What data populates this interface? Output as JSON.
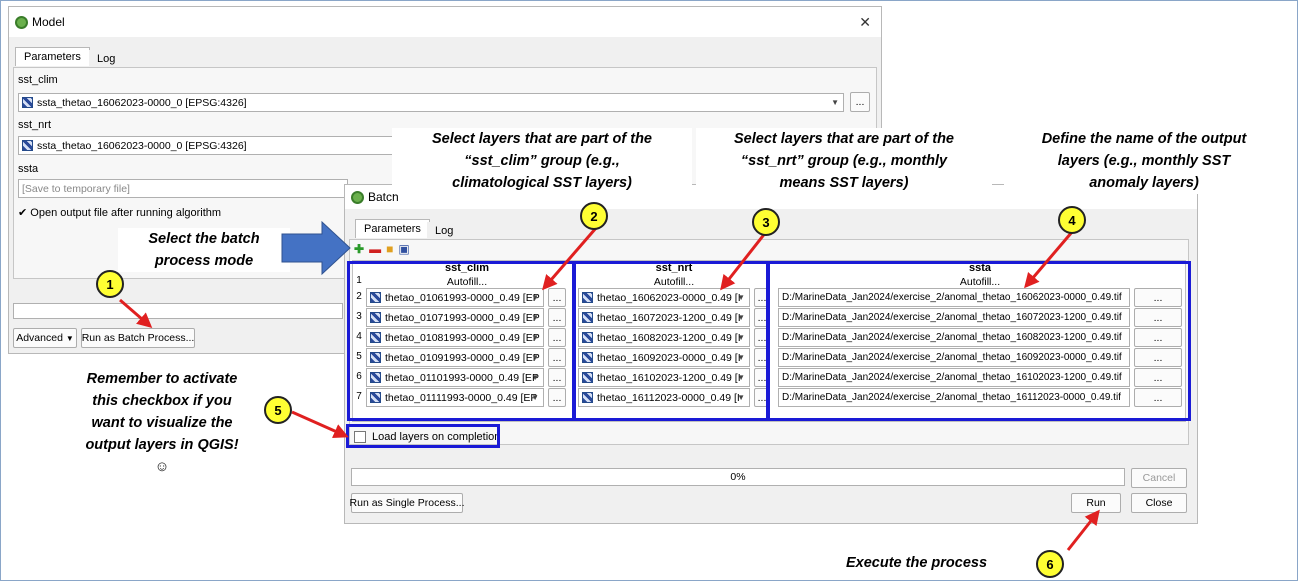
{
  "model_window": {
    "title": "Model",
    "tabs": [
      "Parameters",
      "Log"
    ],
    "sst_clim_label": "sst_clim",
    "sst_clim_value": "ssta_thetao_16062023-0000_0 [EPSG:4326]",
    "sst_nrt_label": "sst_nrt",
    "sst_nrt_value": "ssta_thetao_16062023-0000_0 [EPSG:4326]",
    "ssta_label": "ssta",
    "ssta_placeholder": "[Save to temporary file]",
    "open_output_label": "Open output file after running algorithm",
    "advanced_label": "Advanced",
    "run_batch_label": "Run as Batch Process...",
    "ellipsis": "..."
  },
  "batch_window": {
    "title": "Batch",
    "tabs": [
      "Parameters",
      "Log"
    ],
    "columns": [
      "sst_clim",
      "sst_nrt",
      "ssta"
    ],
    "autofill": "Autofill...",
    "rows": [
      {
        "n": "1"
      },
      {
        "n": "2",
        "clim": "thetao_01061993-0000_0.49 [EP",
        "nrt": "thetao_16062023-0000_0.49 [I",
        "out": "D:/MarineData_Jan2024/exercise_2/anomal_thetao_16062023-0000_0.49.tif"
      },
      {
        "n": "3",
        "clim": "thetao_01071993-0000_0.49 [EP",
        "nrt": "thetao_16072023-1200_0.49 [I",
        "out": "D:/MarineData_Jan2024/exercise_2/anomal_thetao_16072023-1200_0.49.tif"
      },
      {
        "n": "4",
        "clim": "thetao_01081993-0000_0.49 [EP",
        "nrt": "thetao_16082023-1200_0.49 [I",
        "out": "D:/MarineData_Jan2024/exercise_2/anomal_thetao_16082023-1200_0.49.tif"
      },
      {
        "n": "5",
        "clim": "thetao_01091993-0000_0.49 [EP",
        "nrt": "thetao_16092023-0000_0.49 [I",
        "out": "D:/MarineData_Jan2024/exercise_2/anomal_thetao_16092023-0000_0.49.tif"
      },
      {
        "n": "6",
        "clim": "thetao_01101993-0000_0.49 [EP",
        "nrt": "thetao_16102023-1200_0.49 [I",
        "out": "D:/MarineData_Jan2024/exercise_2/anomal_thetao_16102023-1200_0.49.tif"
      },
      {
        "n": "7",
        "clim": "thetao_01111993-0000_0.49 [EP",
        "nrt": "thetao_16112023-0000_0.49 [I",
        "out": "D:/MarineData_Jan2024/exercise_2/anomal_thetao_16112023-0000_0.49.tif"
      }
    ],
    "load_layers_label": "Load layers on completion",
    "progress": "0%",
    "progress_fraction": 0,
    "cancel_label": "Cancel",
    "run_single_label": "Run as Single Process...",
    "run_label": "Run",
    "close_label": "Close",
    "ellipsis": "..."
  },
  "annotations": {
    "n1": "1",
    "n2": "2",
    "n3": "3",
    "n4": "4",
    "n5": "5",
    "n6": "6",
    "select_batch": [
      "Select the batch",
      "process mode"
    ],
    "clim_note": [
      "Select layers that are part of the",
      "“sst_clim” group (e.g.,",
      "climatological  SST layers)"
    ],
    "nrt_note": [
      "Select layers that are part of the",
      "“sst_nrt” group (e.g., monthly",
      "means SST layers)"
    ],
    "ssta_note": [
      "Define the name of the output",
      "layers (e.g., monthly SST",
      "anomaly layers)"
    ],
    "remember_note": [
      "Remember to activate",
      "this checkbox if you",
      "want to visualize the",
      "output layers in QGIS!",
      "☺"
    ],
    "execute_note": "Execute the process"
  },
  "colors": {
    "highlight_border": "#1a1ad6",
    "callout_fill": "#ffff33",
    "arrow_red": "#e02020",
    "big_arrow": "#4472c4"
  }
}
